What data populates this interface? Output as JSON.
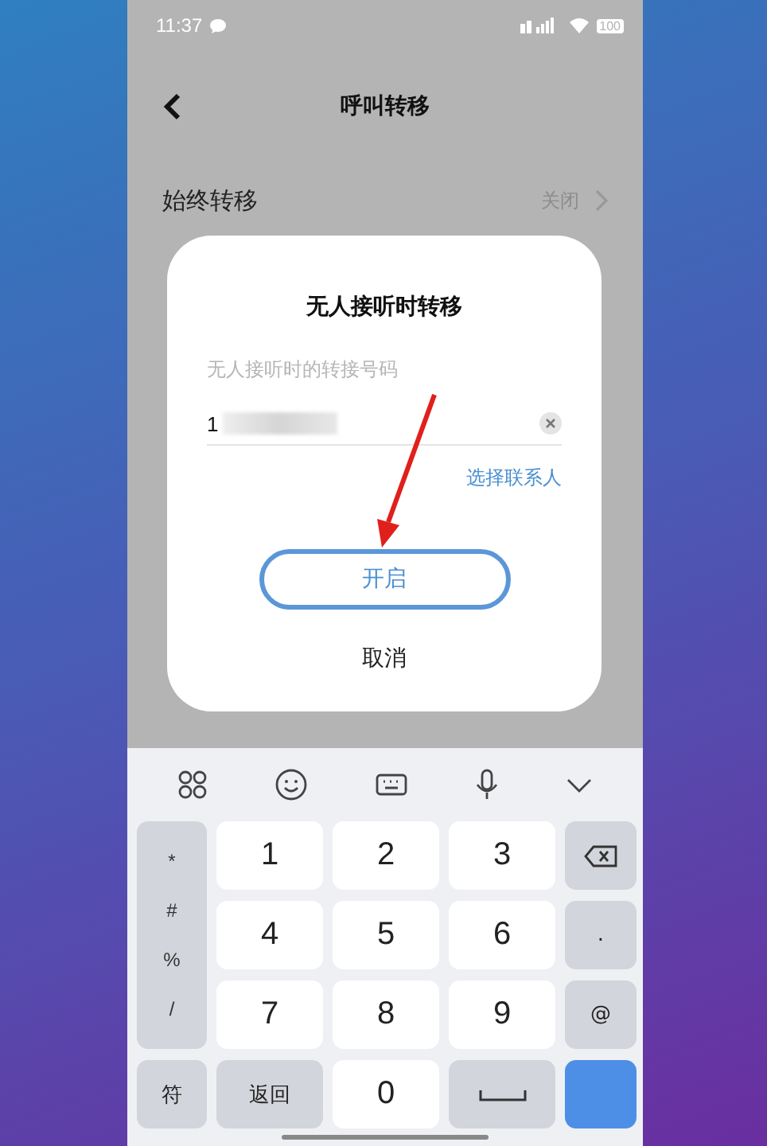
{
  "status_bar": {
    "time": "11:37",
    "battery": "100"
  },
  "header": {
    "title": "呼叫转移"
  },
  "settings": [
    {
      "label": "始终转移",
      "value": "关闭"
    }
  ],
  "dialog": {
    "title": "无人接听时转移",
    "field_label": "无人接听时的转接号码",
    "field_value": "1",
    "link": "选择联系人",
    "buttons": [
      {
        "label": "开启",
        "kind": "primary"
      },
      {
        "label": "取消",
        "kind": "plain"
      }
    ]
  },
  "keyboard": {
    "keys": [
      {
        "kind": "symbols",
        "labels": [
          "*",
          "#",
          "%",
          "/"
        ]
      },
      {
        "kind": "digit",
        "label": "1"
      },
      {
        "kind": "digit",
        "label": "2"
      },
      {
        "kind": "digit",
        "label": "3"
      },
      {
        "kind": "backspace"
      },
      {
        "kind": "digit",
        "label": "4"
      },
      {
        "kind": "digit",
        "label": "5"
      },
      {
        "kind": "digit",
        "label": "6"
      },
      {
        "kind": "side",
        "label": "."
      },
      {
        "kind": "digit",
        "label": "7"
      },
      {
        "kind": "digit",
        "label": "8"
      },
      {
        "kind": "digit",
        "label": "9"
      },
      {
        "kind": "side",
        "label": "@"
      },
      {
        "kind": "side",
        "label": "符"
      },
      {
        "kind": "side",
        "label": "返回"
      },
      {
        "kind": "digit",
        "label": "0"
      },
      {
        "kind": "space"
      },
      {
        "kind": "enter"
      }
    ]
  }
}
